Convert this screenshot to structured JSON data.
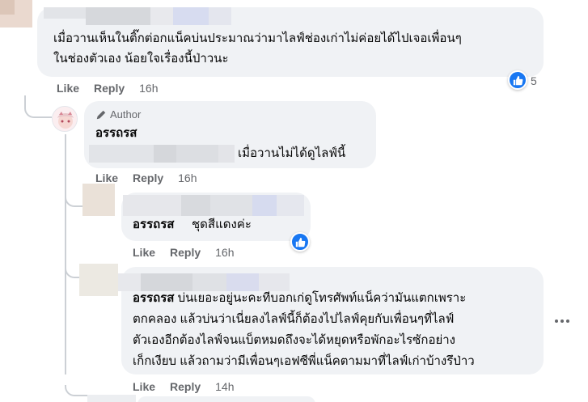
{
  "comments": [
    {
      "text_lines": [
        "เมื่อวานเห็นในติ๊กต่อกแน็คบ่นประมาณว่ามาไลฟ์ช่องเก่าไม่ค่อยได้ไปเจอเพื่อนๆ",
        "ในช่องตัวเอง น้อยใจเรื่องนี้ป่าวนะ"
      ],
      "like_label": "Like",
      "reply_label": "Reply",
      "time": "16h",
      "reaction_count": "5",
      "reaction_icon": "like-icon"
    }
  ],
  "replies": [
    {
      "author_badge": "Author",
      "author_icon": "pencil-icon",
      "name": "อรรถรส",
      "text": "เมื่อวานไม่ได้ดูไลฟ์นี้",
      "like_label": "Like",
      "reply_label": "Reply",
      "time": "16h"
    },
    {
      "name": "อรรถรส",
      "text": "ชุดสีแดงค่ะ",
      "like_label": "Like",
      "reply_label": "Reply",
      "time": "16h",
      "reaction_icon": "like-icon"
    },
    {
      "name": "อรรถรส",
      "text_first": " บ่นเยอะอยู่นะคะทีบอกเก่ดูโทรศัพท์แน็คว่ามันแตกเพราะ",
      "text_lines": [
        "ตกคลอง แล้วบ่นว่าเนี่ยลงไลฟ์นี้ก็ต้องไปไลฟ์คุยกับเพื่อนๆที่ไลฟ์",
        "ตัวเองอีกต้องไลฟ์จนแบ็ตหมดถึงจะได้หยุดหรือพักอะไรซักอย่าง",
        "เก็กเงียบ แล้วถามว่ามีเพื่อนๆเอฟซีพี่แน็คตามมาที่ไลฟ์เก่าบ้างรึป่าว"
      ],
      "like_label": "Like",
      "reply_label": "Reply",
      "time": "14h",
      "more_icon": "more-options-icon"
    }
  ],
  "colors": {
    "bubble": "#f0f2f5",
    "meta_text": "#65676b",
    "like_blue": "#1877f2",
    "thread_line": "#ccd0d5"
  }
}
